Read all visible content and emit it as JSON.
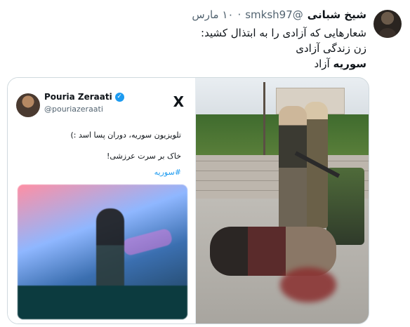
{
  "tweet": {
    "display_name": "شیخ شبانی",
    "handle": "@smksh97",
    "date": "۱۰ مارس",
    "lines": [
      "شعارهایی که آزادی را به ابتذال کشید:",
      "زن زندگی آزادی",
      "سوریه آزاد"
    ],
    "last_line_bold": "سوریه",
    "last_line_rest": " آزاد"
  },
  "embedded_tweet": {
    "name": "Pouria Zeraati",
    "handle": "@pouriazeraati",
    "verified_icon": "verified-badge-icon",
    "logo": "X",
    "line1": "تلویزیون سوریه، دوران پسا اسد :)",
    "line2": "خاک بر سرت عرزشی!",
    "hashtag": "#سوریه"
  },
  "colors": {
    "link": "#1d9bf0",
    "muted": "#536471",
    "text": "#0f1419",
    "border": "#cfd9de"
  }
}
